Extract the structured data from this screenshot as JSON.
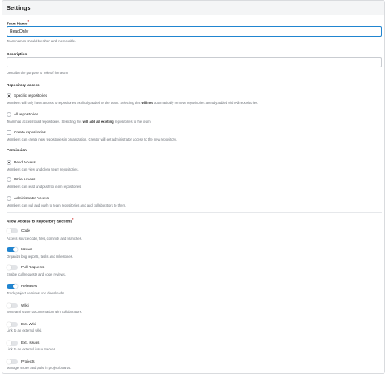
{
  "header": {
    "title": "Settings"
  },
  "team_name": {
    "label": "Team Name",
    "required_mark": "*",
    "value": "ReadOnly",
    "help": "Team names should be short and memorable."
  },
  "description": {
    "label": "Description",
    "value": "",
    "help": "Describe the purpose or role of the team."
  },
  "repository_access": {
    "label": "Repository access",
    "options": [
      {
        "label": "Specific repositories",
        "selected": true,
        "help_prefix": "Members will only have access to repositories explicitly added to the team. Selecting this ",
        "help_bold": "will not",
        "help_suffix": " automatically remove repositories already added with All repositories."
      },
      {
        "label": "All repositories",
        "selected": false,
        "help_prefix": "Team has access to all repositories. Selecting this ",
        "help_bold": "will add all existing",
        "help_suffix": " repositories to the team."
      }
    ],
    "create_repos": {
      "label": "Create repositories",
      "checked": false,
      "help": "Members can create new repositories in organization. Creator will get administrator access to the new repository."
    }
  },
  "permission": {
    "label": "Permission",
    "options": [
      {
        "label": "Read Access",
        "selected": true,
        "help": "Members can view and clone team repositories."
      },
      {
        "label": "Write Access",
        "selected": false,
        "help": "Members can read and push to team repositories."
      },
      {
        "label": "Administrator Access",
        "selected": false,
        "help": "Members can pull and push to team repositories and add collaborators to them."
      }
    ]
  },
  "sections": {
    "label": "Allow Access to Repository Sections",
    "required_mark": "*",
    "items": [
      {
        "label": "Code",
        "on": false,
        "help": "Access source code, files, commits and branches."
      },
      {
        "label": "Issues",
        "on": true,
        "help": "Organize bug reports, tasks and milestones."
      },
      {
        "label": "Pull Requests",
        "on": false,
        "help": "Enable pull requests and code reviews."
      },
      {
        "label": "Releases",
        "on": true,
        "help": "Track project versions and downloads."
      },
      {
        "label": "Wiki",
        "on": false,
        "help": "Write and share documentation with collaborators."
      },
      {
        "label": "Ext. Wiki",
        "on": false,
        "help": "Link to an external wiki."
      },
      {
        "label": "Ext. Issues",
        "on": false,
        "help": "Link to an external issue tracker."
      },
      {
        "label": "Projects",
        "on": false,
        "help": "Manage issues and pulls in project boards."
      }
    ]
  }
}
